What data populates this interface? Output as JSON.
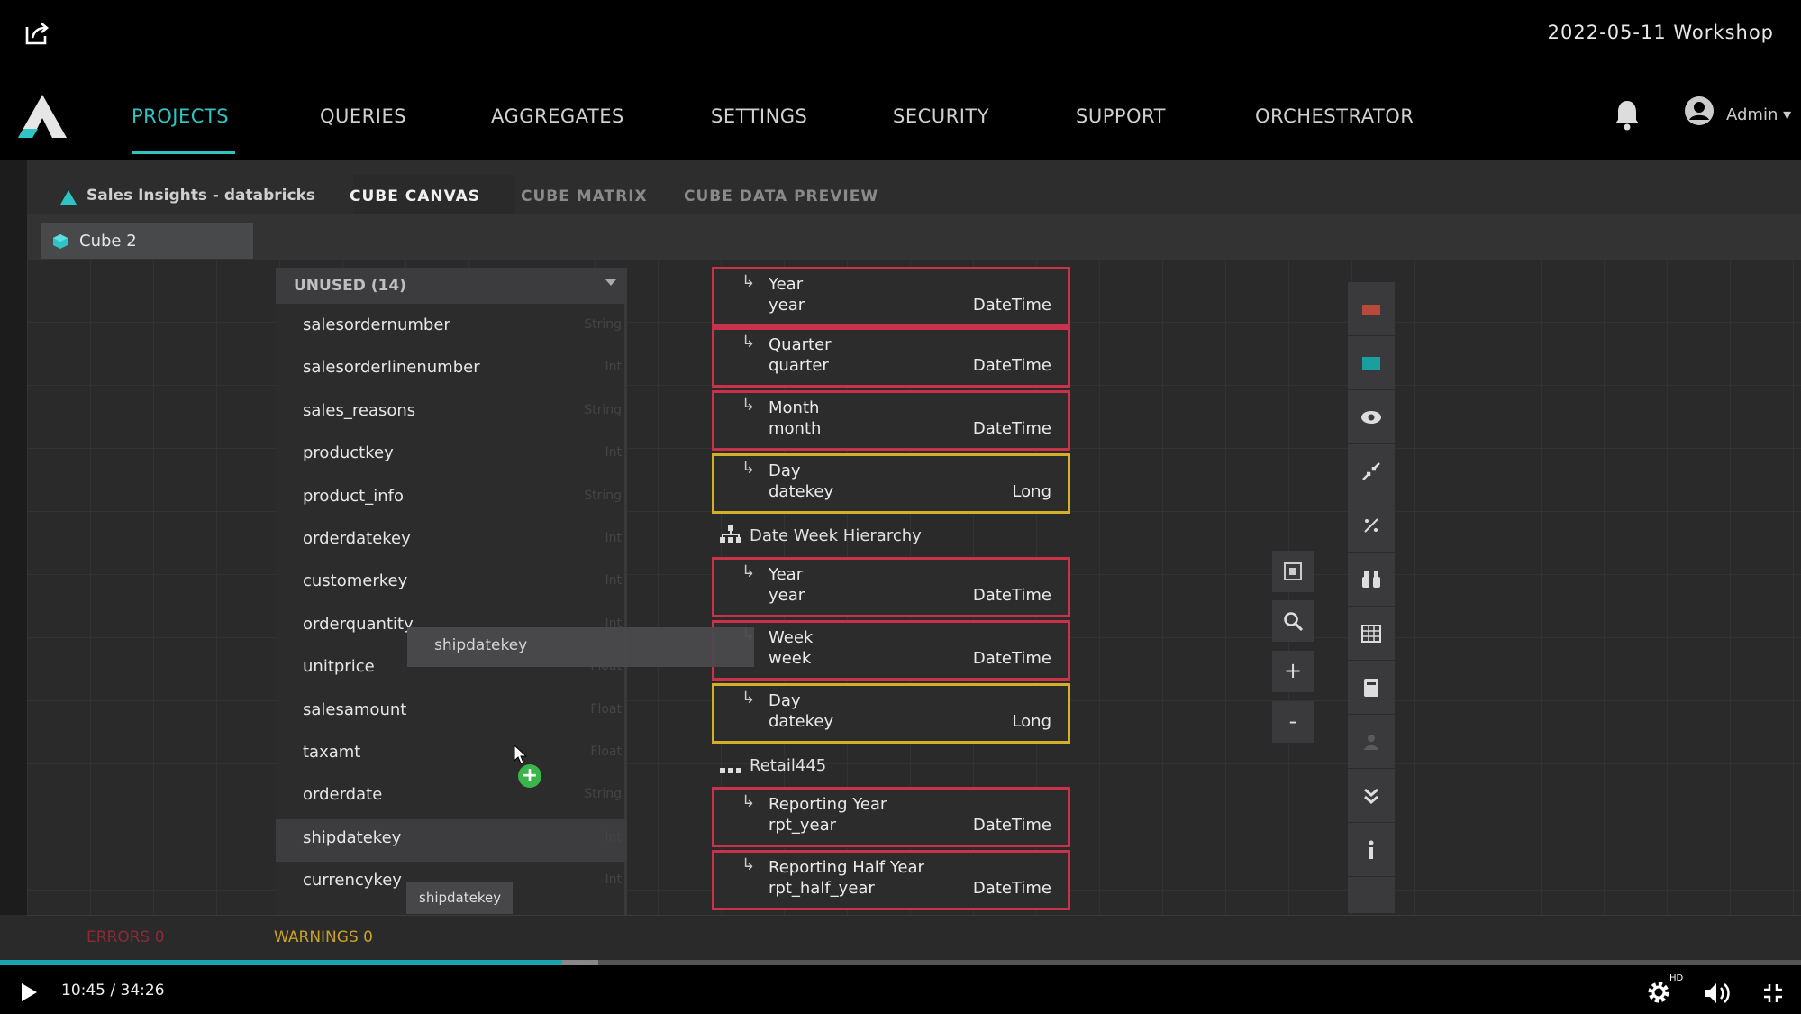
{
  "video": {
    "title": "2022-05-11 Workshop",
    "time": "10:45 / 34:26",
    "progress_pct": 31.2,
    "buffer_pct": 33.2,
    "hd_badge": "HD"
  },
  "nav": {
    "items": [
      "PROJECTS",
      "QUERIES",
      "AGGREGATES",
      "SETTINGS",
      "SECURITY",
      "SUPPORT",
      "ORCHESTRATOR"
    ],
    "active": "PROJECTS",
    "user": "Admin"
  },
  "tabs": {
    "project": "Sales Insights - databricks",
    "items": [
      "CUBE CANVAS",
      "CUBE MATRIX",
      "CUBE DATA PREVIEW"
    ],
    "active": "CUBE CANVAS"
  },
  "cube": {
    "name": "Cube 2"
  },
  "unused": {
    "title": "UNUSED (14)",
    "fields": [
      {
        "name": "salesordernumber",
        "type": "String"
      },
      {
        "name": "salesorderlinenumber",
        "type": "Int"
      },
      {
        "name": "sales_reasons",
        "type": "String"
      },
      {
        "name": "productkey",
        "type": "Int"
      },
      {
        "name": "product_info",
        "type": "String"
      },
      {
        "name": "orderdatekey",
        "type": "Int"
      },
      {
        "name": "customerkey",
        "type": "Int"
      },
      {
        "name": "orderquantity",
        "type": "Int"
      },
      {
        "name": "unitprice",
        "type": "Float"
      },
      {
        "name": "salesamount",
        "type": "Float"
      },
      {
        "name": "taxamt",
        "type": "Float"
      },
      {
        "name": "orderdate",
        "type": "String"
      },
      {
        "name": "shipdatekey",
        "type": "Int"
      },
      {
        "name": "currencykey",
        "type": "Int"
      }
    ],
    "selected": "shipdatekey"
  },
  "drag": {
    "label": "shipdatekey",
    "tooltip": "shipdatekey"
  },
  "hierarchies": {
    "date": {
      "levels": [
        {
          "title": "Year",
          "sub": "year",
          "type": "DateTime"
        },
        {
          "title": "Quarter",
          "sub": "quarter",
          "type": "DateTime"
        },
        {
          "title": "Month",
          "sub": "month",
          "type": "DateTime"
        },
        {
          "title": "Day",
          "sub": "datekey",
          "type": "Long"
        }
      ]
    },
    "date_week": {
      "name": "Date Week Hierarchy",
      "levels": [
        {
          "title": "Year",
          "sub": "year",
          "type": "DateTime"
        },
        {
          "title": "Week",
          "sub": "week",
          "type": "DateTime"
        },
        {
          "title": "Day",
          "sub": "datekey",
          "type": "Long"
        }
      ]
    },
    "retail": {
      "name": "Retail445",
      "levels": [
        {
          "title": "Reporting Year",
          "sub": "rpt_year",
          "type": "DateTime"
        },
        {
          "title": "Reporting Half Year",
          "sub": "rpt_half_year",
          "type": "DateTime"
        }
      ]
    }
  },
  "zoom": {
    "plus": "+",
    "minus": "-"
  },
  "status": {
    "errors": "ERRORS 0",
    "warnings": "WARNINGS 0"
  }
}
